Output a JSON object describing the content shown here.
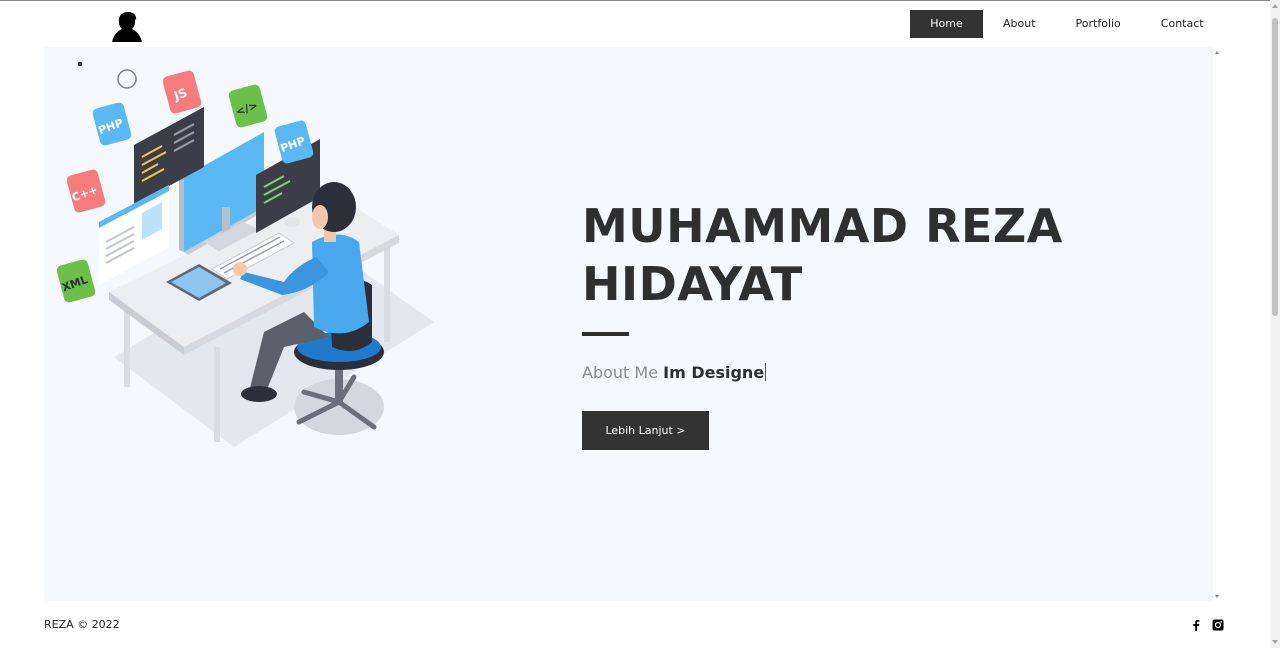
{
  "header": {
    "logo_icon": "person-silhouette-icon",
    "nav": [
      {
        "label": "Home",
        "active": true
      },
      {
        "label": "About",
        "active": false
      },
      {
        "label": "Portfolio",
        "active": false
      },
      {
        "label": "Contact",
        "active": false
      }
    ]
  },
  "hero": {
    "title_line1": "MUHAMMAD REZA",
    "title_line2": "HIDAYAT",
    "tagline_prefix": "About Me",
    "tagline_typed": "Im Designe",
    "cta_label": "Lebih Lanjut >",
    "illustration_icon": "developer-at-desk-illustration",
    "badges": [
      "PHP",
      "JS",
      "</>",
      "PHP",
      "C++",
      "XML"
    ]
  },
  "footer": {
    "copyright": "REZA © 2022",
    "social": [
      {
        "icon": "facebook-icon"
      },
      {
        "icon": "instagram-icon"
      }
    ]
  },
  "colors": {
    "accent": "#333333",
    "hero_bg": "#f5f9fd",
    "text": "#2f2f2f",
    "muted": "#8a8a8a"
  }
}
